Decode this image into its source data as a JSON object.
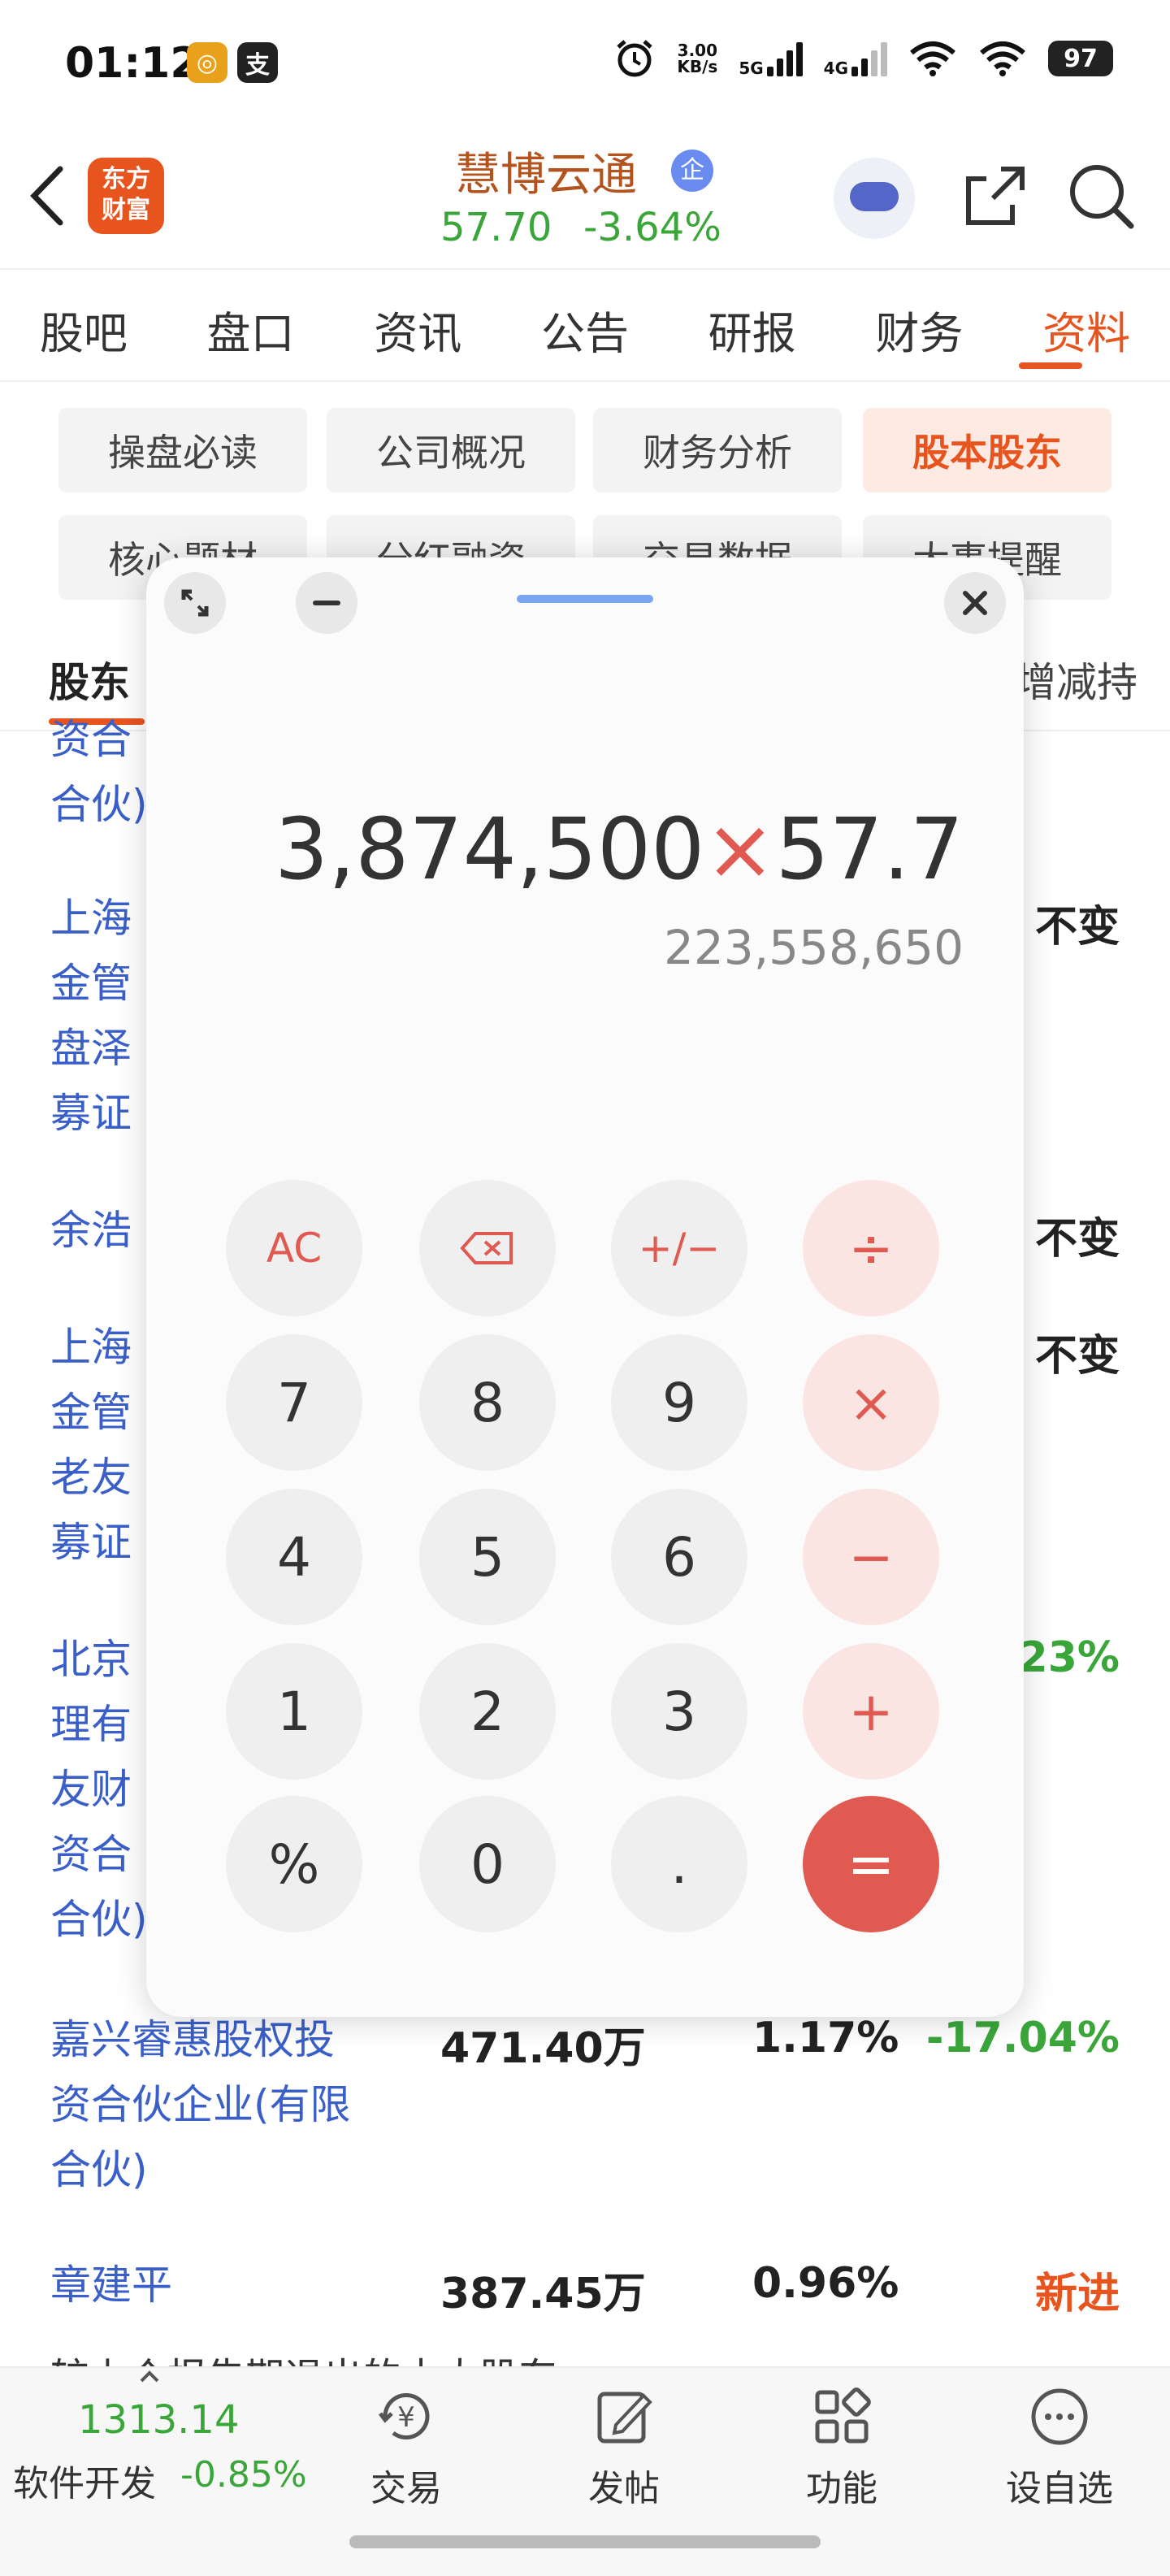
{
  "status_bar": {
    "time": "01:12",
    "net_speed_value": "3.00",
    "net_speed_unit": "KB/s",
    "sim1": "5G",
    "sim2": "4G",
    "battery": "97"
  },
  "header": {
    "logo_line1": "东方",
    "logo_line2": "财富",
    "stock_name": "慧博云通",
    "badge": "企",
    "price": "57.70",
    "change": "-3.64%"
  },
  "tabs": [
    "股吧",
    "盘口",
    "资讯",
    "公告",
    "研报",
    "财务",
    "资料"
  ],
  "chips": [
    "操盘必读",
    "公司概况",
    "财务分析",
    "股本股东",
    "核心题材",
    "分红融资",
    "交易数据",
    "大事提醒"
  ],
  "subtabs": {
    "left": "股东",
    "right": "增减持"
  },
  "list": {
    "partial_top": [
      "资合",
      "合伙)"
    ],
    "rows_partial": [
      {
        "name_lines": [
          "上海",
          "金管",
          "盘泽",
          "募证"
        ],
        "change": "不变"
      },
      {
        "name_lines": [
          "余浩"
        ],
        "change": "不变"
      },
      {
        "name_lines": [
          "上海",
          "金管",
          "老友",
          "募证"
        ],
        "change": "不变"
      },
      {
        "name_lines": [
          "北京",
          "理有",
          "友财",
          "资合",
          "合伙)"
        ],
        "change": "23%"
      }
    ],
    "rows": [
      {
        "name_lines": [
          "嘉兴睿惠股权投",
          "资合伙企业(有限",
          "合伙)"
        ],
        "shares": "471.40万",
        "ratio": "1.17%",
        "change": "-17.04%"
      },
      {
        "name_lines": [
          "章建平"
        ],
        "shares": "387.45万",
        "ratio": "0.96%",
        "change": "新进"
      }
    ],
    "footer_partial": "较上个报告期退出的十大股东"
  },
  "calculator": {
    "expression_left": "3,874,500",
    "expression_op": "×",
    "expression_right": "57.7",
    "result": "223,558,650",
    "keys": [
      [
        "AC",
        "⌫",
        "+/−",
        "÷"
      ],
      [
        "7",
        "8",
        "9",
        "×"
      ],
      [
        "4",
        "5",
        "6",
        "−"
      ],
      [
        "1",
        "2",
        "3",
        "+"
      ],
      [
        "%",
        "0",
        ".",
        "="
      ]
    ]
  },
  "bottom_nav": {
    "index_value": "1313.14",
    "index_name": "软件开发",
    "index_change": "-0.85%",
    "items": [
      "交易",
      "发帖",
      "功能",
      "设自选"
    ]
  },
  "colors": {
    "brand_orange": "#e8541e",
    "up_green": "#3aa63a",
    "link_blue": "#3a5fc9",
    "calc_red": "#e05a52"
  }
}
